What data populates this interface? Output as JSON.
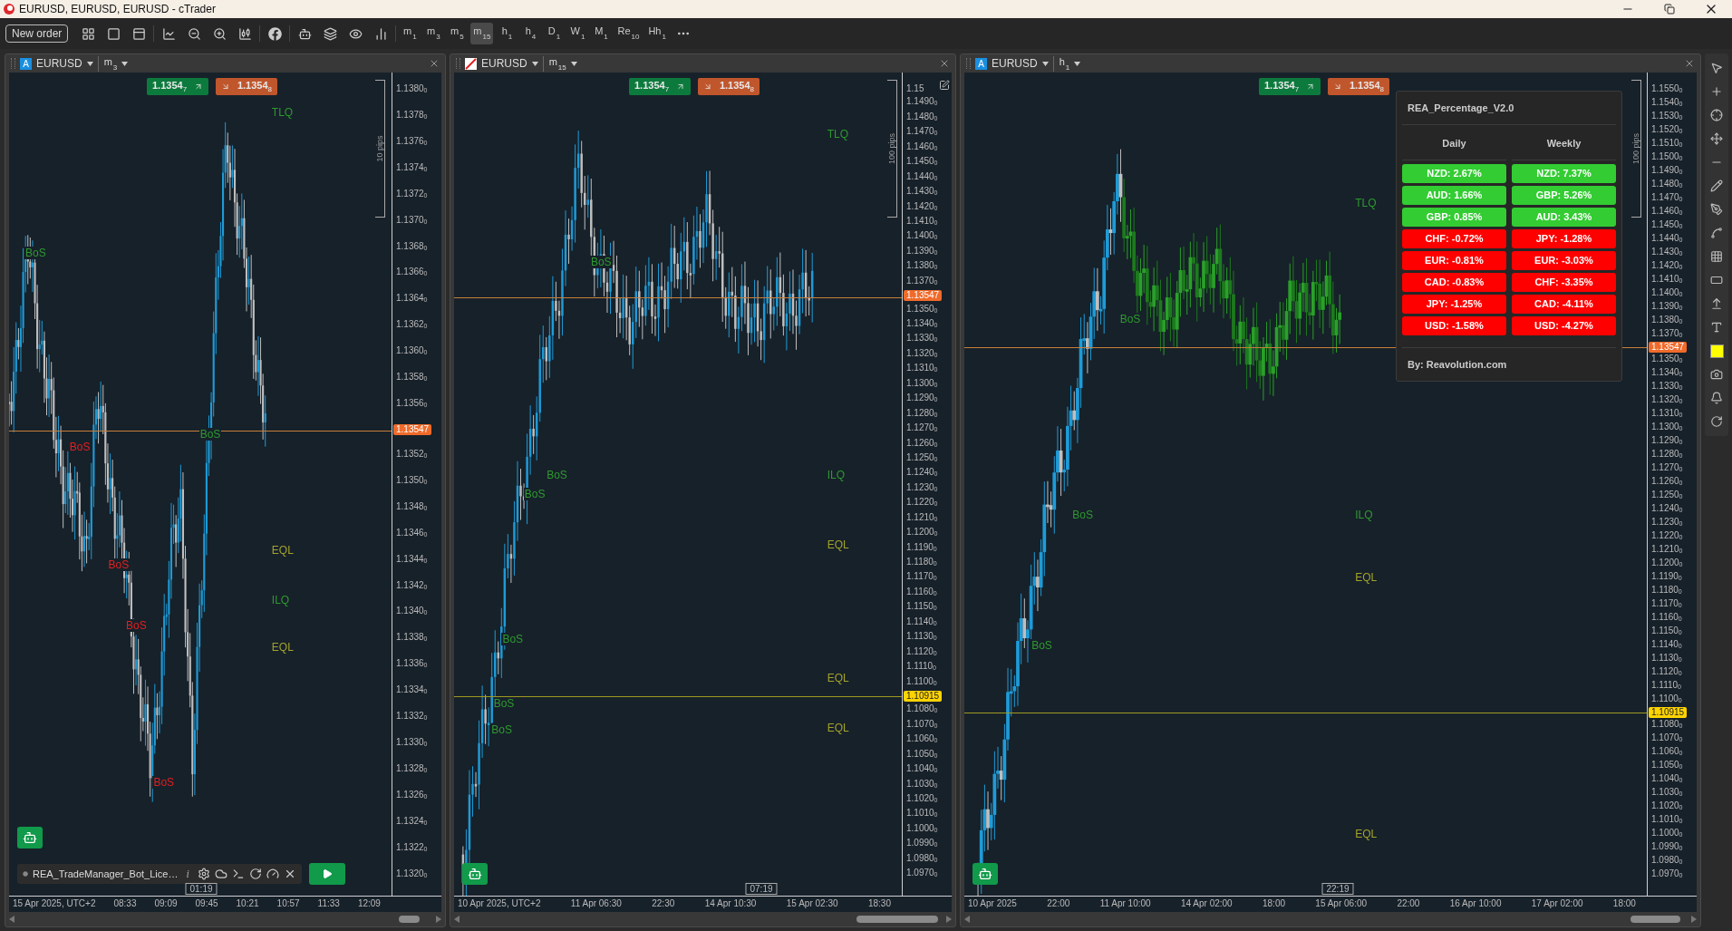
{
  "window": {
    "title": "EURUSD, EURUSD, EURUSD - cTrader"
  },
  "toolbar": {
    "new_order": "New order",
    "timeframes": [
      {
        "main": "m",
        "sub": "1",
        "selected": false
      },
      {
        "main": "m",
        "sub": "3",
        "selected": false
      },
      {
        "main": "m",
        "sub": "5",
        "selected": false
      },
      {
        "main": "m",
        "sub": "15",
        "selected": true
      },
      {
        "main": "h",
        "sub": "1",
        "selected": false
      },
      {
        "main": "h",
        "sub": "4",
        "selected": false
      },
      {
        "main": "D",
        "sub": "1",
        "selected": false
      },
      {
        "main": "W",
        "sub": "1",
        "selected": false
      },
      {
        "main": "M",
        "sub": "1",
        "selected": false
      },
      {
        "main": "Re",
        "sub": "10",
        "selected": false
      },
      {
        "main": "Hh",
        "sub": "1",
        "selected": false
      }
    ]
  },
  "charts": [
    {
      "badge": "A",
      "symbol": "EURUSD",
      "timeframe": {
        "main": "m",
        "sub": "3"
      },
      "bid": "1.1354$_{7}$",
      "ask": "1.1354$_{8}$",
      "range_label": "10 pips",
      "price_axis": [
        {
          "kind": "label",
          "text": "1.1380$_{0}$"
        },
        {
          "kind": "label",
          "text": "1.1378$_{0}$"
        },
        {
          "kind": "label",
          "text": "1.1376$_{0}$"
        },
        {
          "kind": "label",
          "text": "1.1374$_{0}$"
        },
        {
          "kind": "label",
          "text": "1.1372$_{0}$"
        },
        {
          "kind": "label",
          "text": "1.1370$_{0}$"
        },
        {
          "kind": "label",
          "text": "1.1368$_{0}$"
        },
        {
          "kind": "label",
          "text": "1.1366$_{0}$"
        },
        {
          "kind": "label",
          "text": "1.1364$_{0}$"
        },
        {
          "kind": "label",
          "text": "1.1362$_{0}$"
        },
        {
          "kind": "label",
          "text": "1.1360$_{0}$"
        },
        {
          "kind": "label",
          "text": "1.1358$_{0}$"
        },
        {
          "kind": "label",
          "text": "1.1356$_{0}$"
        },
        {
          "kind": "current",
          "text": "1.13547"
        },
        {
          "kind": "label",
          "text": "1.1352$_{0}$"
        },
        {
          "kind": "label",
          "text": "1.1350$_{0}$"
        },
        {
          "kind": "label",
          "text": "1.1348$_{0}$"
        },
        {
          "kind": "label",
          "text": "1.1346$_{0}$"
        },
        {
          "kind": "label",
          "text": "1.1344$_{0}$"
        },
        {
          "kind": "label",
          "text": "1.1342$_{0}$"
        },
        {
          "kind": "label",
          "text": "1.1340$_{0}$"
        },
        {
          "kind": "label",
          "text": "1.1338$_{0}$"
        },
        {
          "kind": "label",
          "text": "1.1336$_{0}$"
        },
        {
          "kind": "label",
          "text": "1.1334$_{0}$"
        },
        {
          "kind": "label",
          "text": "1.1332$_{0}$"
        },
        {
          "kind": "label",
          "text": "1.1330$_{0}$"
        },
        {
          "kind": "label",
          "text": "1.1328$_{0}$"
        },
        {
          "kind": "label",
          "text": "1.1326$_{0}$"
        },
        {
          "kind": "label",
          "text": "1.1324$_{0}$"
        },
        {
          "kind": "label",
          "text": "1.1322$_{0}$"
        },
        {
          "kind": "label",
          "text": "1.1320$_{0}$"
        }
      ],
      "time_axis": [
        "15 Apr 2025, UTC+2",
        "08:33",
        "09:09",
        "09:45",
        "10:21",
        "10:57",
        "11:33",
        "12:09"
      ],
      "time_cursor": "01:19",
      "annotations": [
        {
          "text": "TLQ",
          "color": "#2e9a2e"
        },
        {
          "text": "BoS",
          "color": "#2e9a2e"
        },
        {
          "text": "BoS",
          "color": "#e02020"
        },
        {
          "text": "BoS",
          "color": "#2e9a2e"
        },
        {
          "text": "EQL",
          "color": "#a3a32a"
        },
        {
          "text": "BoS",
          "color": "#e02020"
        },
        {
          "text": "ILQ",
          "color": "#2e9a2e"
        },
        {
          "text": "BoS",
          "color": "#e02020"
        },
        {
          "text": "EQL",
          "color": "#a3a32a"
        },
        {
          "text": "BoS",
          "color": "#e02020"
        }
      ],
      "bot": {
        "name": "REA_TradeManager_Bot_Lice…",
        "info": "i"
      }
    },
    {
      "symbol": "EURUSD",
      "timeframe": {
        "main": "m",
        "sub": "15"
      },
      "bid": "1.1354$_{7}$",
      "ask": "1.1354$_{8}$",
      "range_label": "100 pips",
      "price_axis": [
        {
          "kind": "label",
          "text": "1.15"
        },
        {
          "kind": "label",
          "text": "1.1490$_{0}$"
        },
        {
          "kind": "label",
          "text": "1.1480$_{0}$"
        },
        {
          "kind": "label",
          "text": "1.1470$_{0}$"
        },
        {
          "kind": "label",
          "text": "1.1460$_{0}$"
        },
        {
          "kind": "label",
          "text": "1.1450$_{0}$"
        },
        {
          "kind": "label",
          "text": "1.1440$_{0}$"
        },
        {
          "kind": "label",
          "text": "1.1430$_{0}$"
        },
        {
          "kind": "label",
          "text": "1.1420$_{0}$"
        },
        {
          "kind": "label",
          "text": "1.1410$_{0}$"
        },
        {
          "kind": "label",
          "text": "1.1400$_{0}$"
        },
        {
          "kind": "label",
          "text": "1.1390$_{0}$"
        },
        {
          "kind": "label",
          "text": "1.1380$_{0}$"
        },
        {
          "kind": "label",
          "text": "1.1370$_{0}$"
        },
        {
          "kind": "current",
          "text": "1.13547"
        },
        {
          "kind": "label",
          "text": "1.1350$_{0}$"
        },
        {
          "kind": "label",
          "text": "1.1340$_{0}$"
        },
        {
          "kind": "label",
          "text": "1.1330$_{0}$"
        },
        {
          "kind": "label",
          "text": "1.1320$_{0}$"
        },
        {
          "kind": "label",
          "text": "1.1310$_{0}$"
        },
        {
          "kind": "label",
          "text": "1.1300$_{0}$"
        },
        {
          "kind": "label",
          "text": "1.1290$_{0}$"
        },
        {
          "kind": "label",
          "text": "1.1280$_{0}$"
        },
        {
          "kind": "label",
          "text": "1.1270$_{0}$"
        },
        {
          "kind": "label",
          "text": "1.1260$_{0}$"
        },
        {
          "kind": "label",
          "text": "1.1250$_{0}$"
        },
        {
          "kind": "label",
          "text": "1.1240$_{0}$"
        },
        {
          "kind": "label",
          "text": "1.1230$_{0}$"
        },
        {
          "kind": "label",
          "text": "1.1220$_{0}$"
        },
        {
          "kind": "label",
          "text": "1.1210$_{0}$"
        },
        {
          "kind": "label",
          "text": "1.1200$_{0}$"
        },
        {
          "kind": "label",
          "text": "1.1190$_{0}$"
        },
        {
          "kind": "label",
          "text": "1.1180$_{0}$"
        },
        {
          "kind": "label",
          "text": "1.1170$_{0}$"
        },
        {
          "kind": "label",
          "text": "1.1160$_{0}$"
        },
        {
          "kind": "label",
          "text": "1.1150$_{0}$"
        },
        {
          "kind": "label",
          "text": "1.1140$_{0}$"
        },
        {
          "kind": "label",
          "text": "1.1130$_{0}$"
        },
        {
          "kind": "label",
          "text": "1.1120$_{0}$"
        },
        {
          "kind": "label",
          "text": "1.1110$_{0}$"
        },
        {
          "kind": "label",
          "text": "1.1100$_{0}$"
        },
        {
          "kind": "marker",
          "text": "1.10915"
        },
        {
          "kind": "label",
          "text": "1.1080$_{0}$"
        },
        {
          "kind": "label",
          "text": "1.1070$_{0}$"
        },
        {
          "kind": "label",
          "text": "1.1060$_{0}$"
        },
        {
          "kind": "label",
          "text": "1.1050$_{0}$"
        },
        {
          "kind": "label",
          "text": "1.1040$_{0}$"
        },
        {
          "kind": "label",
          "text": "1.1030$_{0}$"
        },
        {
          "kind": "label",
          "text": "1.1020$_{0}$"
        },
        {
          "kind": "label",
          "text": "1.1010$_{0}$"
        },
        {
          "kind": "label",
          "text": "1.1000$_{0}$"
        },
        {
          "kind": "label",
          "text": "1.0990$_{0}$"
        },
        {
          "kind": "label",
          "text": "1.0980$_{0}$"
        },
        {
          "kind": "label",
          "text": "1.0970$_{0}$"
        }
      ],
      "time_axis": [
        "10 Apr 2025, UTC+2",
        "11 Apr 06:30",
        "22:30",
        "14 Apr 10:30",
        "15 Apr 02:30",
        "18:30"
      ],
      "time_cursor": "07:19",
      "annotations": [
        {
          "text": "TLQ",
          "color": "#2e9a2e"
        },
        {
          "text": "BoS",
          "color": "#2e9a2e"
        },
        {
          "text": "ILQ",
          "color": "#2e9a2e"
        },
        {
          "text": "BoS",
          "color": "#2e9a2e"
        },
        {
          "text": "BoS",
          "color": "#2e9a2e"
        },
        {
          "text": "EQL",
          "color": "#a3a32a"
        },
        {
          "text": "BoS",
          "color": "#2e9a2e"
        },
        {
          "text": "EQL",
          "color": "#a3a32a"
        },
        {
          "text": "BoS",
          "color": "#2e9a2e"
        },
        {
          "text": "EQL",
          "color": "#a3a32a"
        },
        {
          "text": "BoS",
          "color": "#2e9a2e"
        }
      ]
    },
    {
      "badge": "A",
      "symbol": "EURUSD",
      "timeframe": {
        "main": "h",
        "sub": "1"
      },
      "bid": "1.1354$_{7}$",
      "ask": "1.1354$_{8}$",
      "range_label": "100 pips",
      "price_axis": [
        {
          "kind": "label",
          "text": "1.1550$_{0}$"
        },
        {
          "kind": "label",
          "text": "1.1540$_{0}$"
        },
        {
          "kind": "label",
          "text": "1.1530$_{0}$"
        },
        {
          "kind": "label",
          "text": "1.1520$_{0}$"
        },
        {
          "kind": "label",
          "text": "1.1510$_{0}$"
        },
        {
          "kind": "label",
          "text": "1.1500$_{0}$"
        },
        {
          "kind": "label",
          "text": "1.1490$_{0}$"
        },
        {
          "kind": "label",
          "text": "1.1480$_{0}$"
        },
        {
          "kind": "label",
          "text": "1.1470$_{0}$"
        },
        {
          "kind": "label",
          "text": "1.1460$_{0}$"
        },
        {
          "kind": "label",
          "text": "1.1450$_{0}$"
        },
        {
          "kind": "label",
          "text": "1.1440$_{0}$"
        },
        {
          "kind": "label",
          "text": "1.1430$_{0}$"
        },
        {
          "kind": "label",
          "text": "1.1420$_{0}$"
        },
        {
          "kind": "label",
          "text": "1.1410$_{0}$"
        },
        {
          "kind": "label",
          "text": "1.1400$_{0}$"
        },
        {
          "kind": "label",
          "text": "1.1390$_{0}$"
        },
        {
          "kind": "label",
          "text": "1.1380$_{0}$"
        },
        {
          "kind": "label",
          "text": "1.1370$_{0}$"
        },
        {
          "kind": "current",
          "text": "1.13547"
        },
        {
          "kind": "label",
          "text": "1.1350$_{0}$"
        },
        {
          "kind": "label",
          "text": "1.1340$_{0}$"
        },
        {
          "kind": "label",
          "text": "1.1330$_{0}$"
        },
        {
          "kind": "label",
          "text": "1.1320$_{0}$"
        },
        {
          "kind": "label",
          "text": "1.1310$_{0}$"
        },
        {
          "kind": "label",
          "text": "1.1300$_{0}$"
        },
        {
          "kind": "label",
          "text": "1.1290$_{0}$"
        },
        {
          "kind": "label",
          "text": "1.1280$_{0}$"
        },
        {
          "kind": "label",
          "text": "1.1270$_{0}$"
        },
        {
          "kind": "label",
          "text": "1.1260$_{0}$"
        },
        {
          "kind": "label",
          "text": "1.1250$_{0}$"
        },
        {
          "kind": "label",
          "text": "1.1240$_{0}$"
        },
        {
          "kind": "label",
          "text": "1.1230$_{0}$"
        },
        {
          "kind": "label",
          "text": "1.1220$_{0}$"
        },
        {
          "kind": "label",
          "text": "1.1210$_{0}$"
        },
        {
          "kind": "label",
          "text": "1.1200$_{0}$"
        },
        {
          "kind": "label",
          "text": "1.1190$_{0}$"
        },
        {
          "kind": "label",
          "text": "1.1180$_{0}$"
        },
        {
          "kind": "label",
          "text": "1.1170$_{0}$"
        },
        {
          "kind": "label",
          "text": "1.1160$_{0}$"
        },
        {
          "kind": "label",
          "text": "1.1150$_{0}$"
        },
        {
          "kind": "label",
          "text": "1.1140$_{0}$"
        },
        {
          "kind": "label",
          "text": "1.1130$_{0}$"
        },
        {
          "kind": "label",
          "text": "1.1120$_{0}$"
        },
        {
          "kind": "label",
          "text": "1.1110$_{0}$"
        },
        {
          "kind": "label",
          "text": "1.1100$_{0}$"
        },
        {
          "kind": "marker",
          "text": "1.10915"
        },
        {
          "kind": "label",
          "text": "1.1080$_{0}$"
        },
        {
          "kind": "label",
          "text": "1.1070$_{0}$"
        },
        {
          "kind": "label",
          "text": "1.1060$_{0}$"
        },
        {
          "kind": "label",
          "text": "1.1050$_{0}$"
        },
        {
          "kind": "label",
          "text": "1.1040$_{0}$"
        },
        {
          "kind": "label",
          "text": "1.1030$_{0}$"
        },
        {
          "kind": "label",
          "text": "1.1020$_{0}$"
        },
        {
          "kind": "label",
          "text": "1.1010$_{0}$"
        },
        {
          "kind": "label",
          "text": "1.1000$_{0}$"
        },
        {
          "kind": "label",
          "text": "1.0990$_{0}$"
        },
        {
          "kind": "label",
          "text": "1.0980$_{0}$"
        },
        {
          "kind": "label",
          "text": "1.0970$_{0}$"
        }
      ],
      "time_axis": [
        "10 Apr 2025",
        "22:00",
        "11 Apr 10:00",
        "14 Apr 02:00",
        "18:00",
        "15 Apr 06:00",
        "22:00",
        "16 Apr 10:00",
        "17 Apr 02:00",
        "18:00"
      ],
      "time_cursor": "22:19",
      "annotations": [
        {
          "text": "TLQ",
          "color": "#2e9a2e"
        },
        {
          "text": "BoS",
          "color": "#2e9a2e"
        },
        {
          "text": "ILQ",
          "color": "#2e9a2e"
        },
        {
          "text": "BoS",
          "color": "#2e9a2e"
        },
        {
          "text": "EQL",
          "color": "#a3a32a"
        },
        {
          "text": "BoS",
          "color": "#2e9a2e"
        },
        {
          "text": "EQL",
          "color": "#a3a32a"
        }
      ],
      "panel": {
        "title": "REA_Percentage_V2.0",
        "columns": [
          "Daily",
          "Weekly"
        ],
        "rows": [
          {
            "daily": {
              "text": "NZD: 2.67%",
              "color": "#33cc33"
            },
            "weekly": {
              "text": "NZD: 7.37%",
              "color": "#33cc33"
            }
          },
          {
            "daily": {
              "text": "AUD: 1.66%",
              "color": "#33cc33"
            },
            "weekly": {
              "text": "GBP: 5.26%",
              "color": "#33cc33"
            }
          },
          {
            "daily": {
              "text": "GBP: 0.85%",
              "color": "#33cc33"
            },
            "weekly": {
              "text": "AUD: 3.43%",
              "color": "#33cc33"
            }
          },
          {
            "daily": {
              "text": "CHF: -0.72%",
              "color": "#ff0000"
            },
            "weekly": {
              "text": "JPY: -1.28%",
              "color": "#ff0000"
            }
          },
          {
            "daily": {
              "text": "EUR: -0.81%",
              "color": "#ff0000"
            },
            "weekly": {
              "text": "EUR: -3.03%",
              "color": "#ff0000"
            }
          },
          {
            "daily": {
              "text": "CAD: -0.83%",
              "color": "#ff0000"
            },
            "weekly": {
              "text": "CHF: -3.35%",
              "color": "#ff0000"
            }
          },
          {
            "daily": {
              "text": "JPY: -1.25%",
              "color": "#ff0000"
            },
            "weekly": {
              "text": "CAD: -4.11%",
              "color": "#ff0000"
            }
          },
          {
            "daily": {
              "text": "USD: -1.58%",
              "color": "#ff0000"
            },
            "weekly": {
              "text": "USD: -4.27%",
              "color": "#ff0000"
            }
          }
        ],
        "footer": "By: Reavolution.com"
      }
    }
  ]
}
